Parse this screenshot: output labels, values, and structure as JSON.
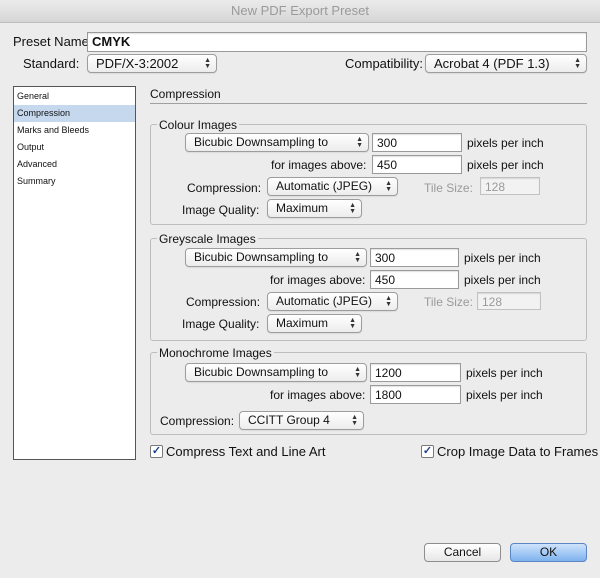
{
  "window": {
    "title": "New PDF Export Preset"
  },
  "preset": {
    "name_label": "Preset Name:",
    "name_value": "CMYK",
    "standard_label": "Standard:",
    "standard_value": "PDF/X-3:2002",
    "compat_label": "Compatibility:",
    "compat_value": "Acrobat 4 (PDF 1.3)"
  },
  "sidebar": {
    "items": [
      {
        "label": "General"
      },
      {
        "label": "Compression"
      },
      {
        "label": "Marks and Bleeds"
      },
      {
        "label": "Output"
      },
      {
        "label": "Advanced"
      },
      {
        "label": "Summary"
      }
    ],
    "selected": "Compression"
  },
  "panel": {
    "title": "Compression"
  },
  "colour": {
    "title": "Colour Images",
    "downsample_method": "Bicubic Downsampling to",
    "ppi": "300",
    "ppi_unit": "pixels per inch",
    "above_label": "for images above:",
    "above_value": "450",
    "above_unit": "pixels per inch",
    "compression_label": "Compression:",
    "compression_value": "Automatic (JPEG)",
    "tile_label": "Tile Size:",
    "tile_value": "128",
    "quality_label": "Image Quality:",
    "quality_value": "Maximum"
  },
  "greyscale": {
    "title": "Greyscale Images",
    "downsample_method": "Bicubic Downsampling to",
    "ppi": "300",
    "ppi_unit": "pixels per inch",
    "above_label": "for images above:",
    "above_value": "450",
    "above_unit": "pixels per inch",
    "compression_label": "Compression:",
    "compression_value": "Automatic (JPEG)",
    "tile_label": "Tile Size:",
    "tile_value": "128",
    "quality_label": "Image Quality:",
    "quality_value": "Maximum"
  },
  "mono": {
    "title": "Monochrome Images",
    "downsample_method": "Bicubic Downsampling to",
    "ppi": "1200",
    "ppi_unit": "pixels per inch",
    "above_label": "for images above:",
    "above_value": "1800",
    "above_unit": "pixels per inch",
    "compression_label": "Compression:",
    "compression_value": "CCITT Group 4"
  },
  "options": {
    "compress_text_label": "Compress Text and Line Art",
    "compress_text_checked": true,
    "crop_label": "Crop Image Data to Frames",
    "crop_checked": true
  },
  "buttons": {
    "cancel": "Cancel",
    "ok": "OK"
  },
  "icons": {
    "popup": "up-down-chevron-icon",
    "check": "checkmark-icon"
  },
  "colors": {
    "selection": "#c5d8ee",
    "ok_button": "#7eb2ef",
    "check": "#1f3f8f"
  }
}
